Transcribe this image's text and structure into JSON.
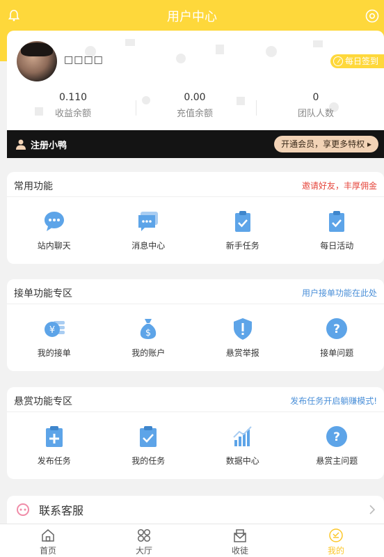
{
  "header": {
    "title": "用户中心"
  },
  "profile": {
    "username": "□□□□",
    "signin_label": "每日签到",
    "stats": [
      {
        "value": "0.110",
        "label": "收益余额"
      },
      {
        "value": "0.00",
        "label": "充值余额"
      },
      {
        "value": "0",
        "label": "团队人数"
      }
    ]
  },
  "vip": {
    "name": "注册小鸭",
    "button": "开通会员，享更多特权 ▸"
  },
  "sections": [
    {
      "title": "常用功能",
      "note": "邀请好友，丰厚佣金",
      "note_color": "#e6463c",
      "items": [
        {
          "label": "站内聊天",
          "icon": "chat-icon"
        },
        {
          "label": "消息中心",
          "icon": "message-icon"
        },
        {
          "label": "新手任务",
          "icon": "task-icon"
        },
        {
          "label": "每日活动",
          "icon": "activity-icon"
        }
      ]
    },
    {
      "title": "接单功能专区",
      "note": "用户接单功能在此处",
      "note_color": "#4a8fd8",
      "items": [
        {
          "label": "我的接单",
          "icon": "coins-icon"
        },
        {
          "label": "我的账户",
          "icon": "money-bag-icon"
        },
        {
          "label": "悬赏举报",
          "icon": "shield-icon"
        },
        {
          "label": "接单问题",
          "icon": "question-icon"
        }
      ]
    },
    {
      "title": "悬赏功能专区",
      "note": "发布任务开启躺赚模式!",
      "note_color": "#4a8fd8",
      "items": [
        {
          "label": "发布任务",
          "icon": "publish-icon"
        },
        {
          "label": "我的任务",
          "icon": "my-task-icon"
        },
        {
          "label": "数据中心",
          "icon": "chart-icon"
        },
        {
          "label": "悬赏主问题",
          "icon": "question-icon"
        }
      ]
    }
  ],
  "service": {
    "label": "联系客服"
  },
  "tabs": [
    {
      "label": "首页",
      "icon": "home-icon"
    },
    {
      "label": "大厅",
      "icon": "hall-icon"
    },
    {
      "label": "收徒",
      "icon": "apprentice-icon"
    },
    {
      "label": "我的",
      "icon": "mine-icon"
    }
  ],
  "colors": {
    "accent": "#fed83b",
    "icon_blue": "#5da4e8"
  }
}
